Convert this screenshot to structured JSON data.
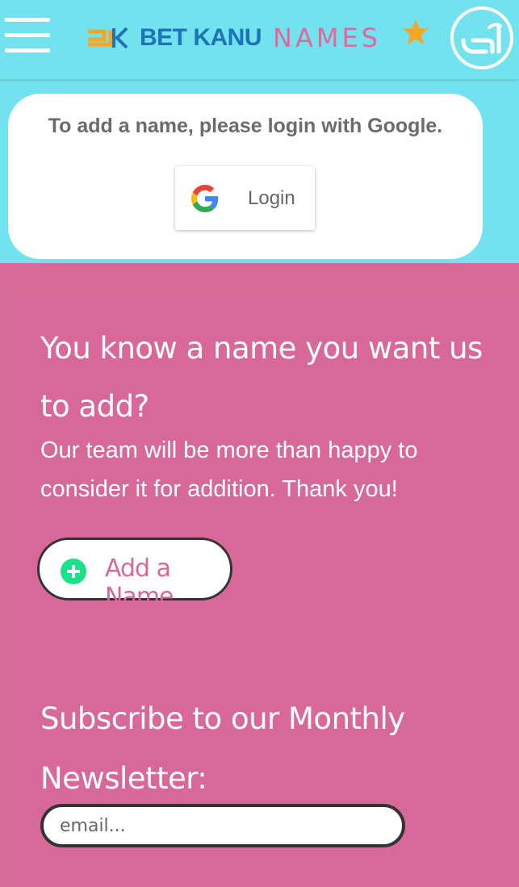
{
  "header": {
    "brand_primary": "BET KANU",
    "brand_secondary": "NAMES",
    "menu_icon": "hamburger-icon",
    "favorite_icon": "star-icon",
    "language_icon": "amharic-language-icon"
  },
  "login": {
    "message": "To add a name, please login with Google.",
    "button_label": "Login",
    "button_icon": "google-icon"
  },
  "add_name": {
    "heading": "You know a name you want us to add?",
    "description": "Our team will be more than happy to consider it for addition. Thank you!",
    "button_label": "Add a Name",
    "button_icon": "plus-icon"
  },
  "newsletter": {
    "heading": "Subscribe to our Monthly Newsletter:",
    "email_placeholder": "email..."
  },
  "colors": {
    "header_bg": "#72e2ee",
    "pink_bg": "#d9689a",
    "brand_blue": "#1e73b8",
    "brand_pink": "#e3679e",
    "star": "#f5a623",
    "plus_green": "#19e28a"
  }
}
